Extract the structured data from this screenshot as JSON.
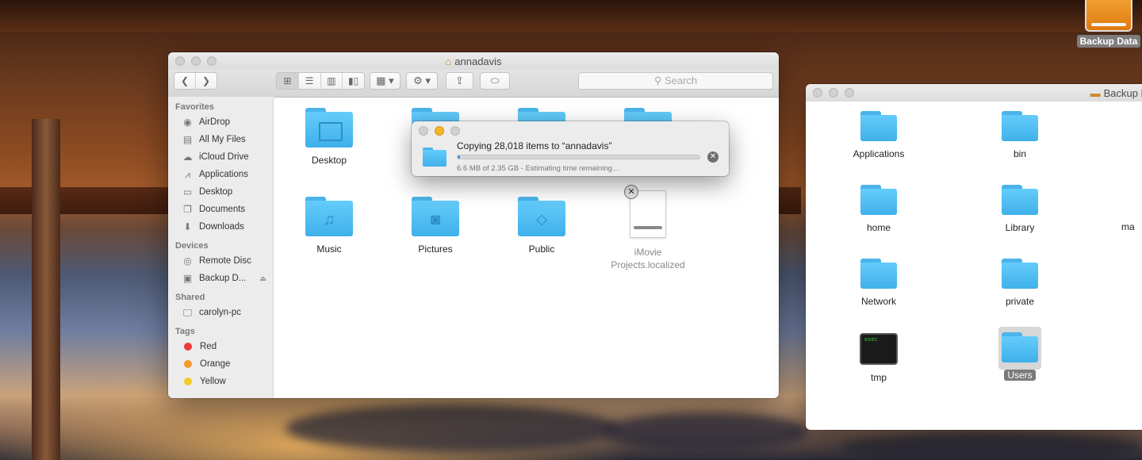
{
  "desktop": {
    "drive_label": "Backup Data"
  },
  "main_window": {
    "title": "annadavis",
    "search_placeholder": "Search",
    "sidebar": {
      "sections": [
        {
          "header": "Favorites",
          "items": [
            {
              "label": "AirDrop",
              "icon": "airdrop-icon"
            },
            {
              "label": "All My Files",
              "icon": "all-files-icon"
            },
            {
              "label": "iCloud Drive",
              "icon": "cloud-icon"
            },
            {
              "label": "Applications",
              "icon": "applications-icon"
            },
            {
              "label": "Desktop",
              "icon": "desktop-icon"
            },
            {
              "label": "Documents",
              "icon": "documents-icon"
            },
            {
              "label": "Downloads",
              "icon": "downloads-icon"
            }
          ]
        },
        {
          "header": "Devices",
          "items": [
            {
              "label": "Remote Disc",
              "icon": "disc-icon"
            },
            {
              "label": "Backup D...",
              "icon": "drive-icon"
            }
          ]
        },
        {
          "header": "Shared",
          "items": [
            {
              "label": "carolyn-pc",
              "icon": "computer-icon"
            }
          ]
        },
        {
          "header": "Tags",
          "items": [
            {
              "label": "Red",
              "color": "#ee3a3a"
            },
            {
              "label": "Orange",
              "color": "#f39a2a"
            },
            {
              "label": "Yellow",
              "color": "#f2cc28"
            }
          ]
        }
      ]
    },
    "items": [
      {
        "label": "Desktop"
      },
      {
        "label": "Music"
      },
      {
        "label": "Pictures"
      },
      {
        "label": "Public"
      },
      {
        "label_line1": "iMovie",
        "label_line2": "Projects.localized"
      }
    ]
  },
  "copy_dialog": {
    "title": "Copying 28,018 items to “annadavis”",
    "status": "6.6 MB of 2.35 GB - Estimating time remaining…",
    "progress": 0.003
  },
  "backup_window": {
    "title": "Backup Data",
    "items": [
      {
        "label": "Applications"
      },
      {
        "label": "bin"
      },
      {
        "label": "home"
      },
      {
        "label": "Library"
      },
      {
        "label": "ma"
      },
      {
        "label": "Network"
      },
      {
        "label": "private"
      },
      {
        "label": "tmp",
        "icon_text": "exec"
      },
      {
        "label": "Users",
        "selected": true
      }
    ]
  }
}
